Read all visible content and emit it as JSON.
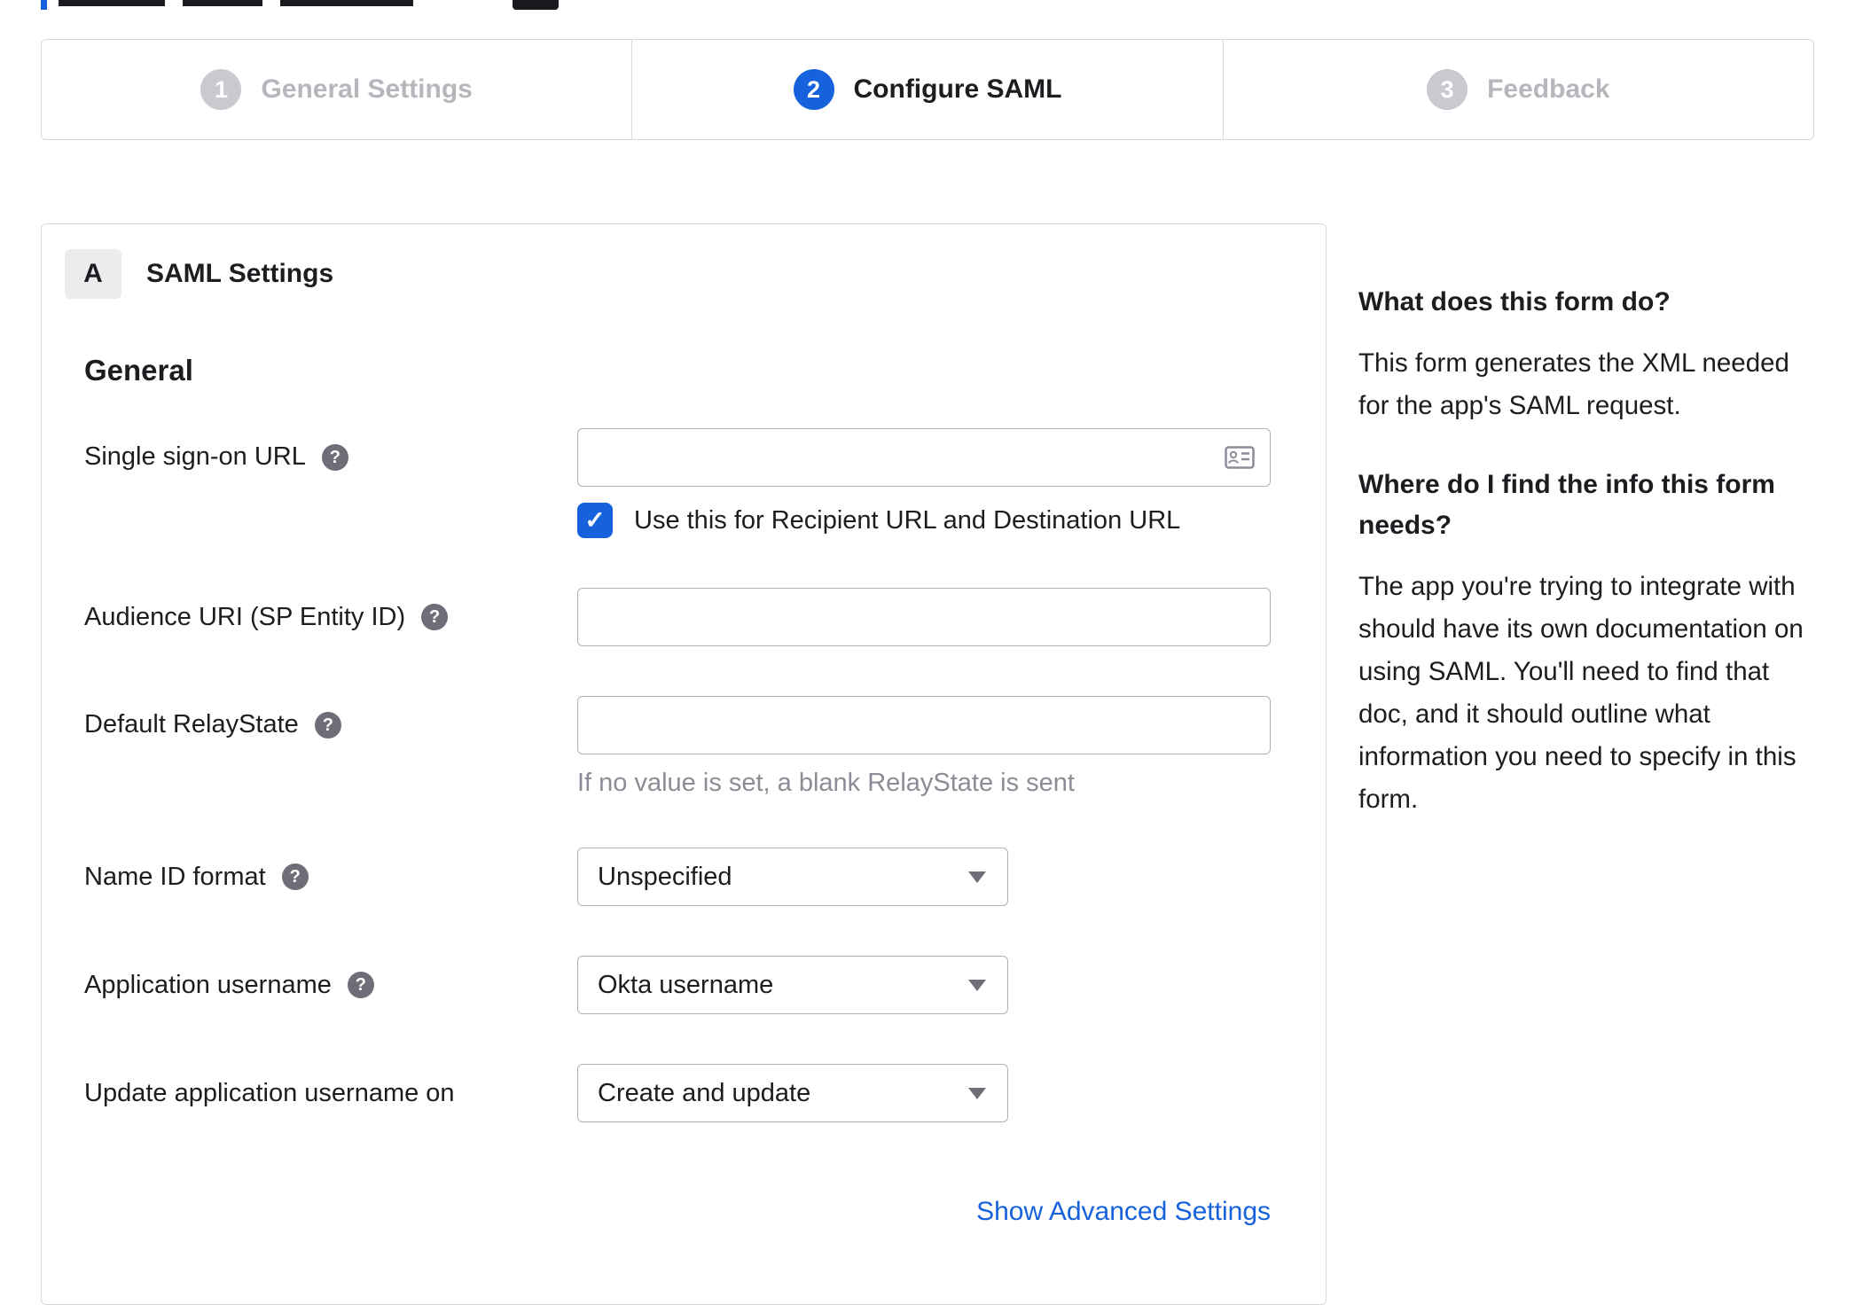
{
  "icons": {
    "help": "?",
    "check": "✓"
  },
  "stepper": {
    "steps": [
      {
        "number": "1",
        "label": "General Settings",
        "state": "inactive"
      },
      {
        "number": "2",
        "label": "Configure SAML",
        "state": "active"
      },
      {
        "number": "3",
        "label": "Feedback",
        "state": "inactive"
      }
    ]
  },
  "panel": {
    "section_badge": "A",
    "section_title": "SAML Settings",
    "group_title": "General",
    "fields": {
      "sso_url": {
        "label": "Single sign-on URL",
        "value": ""
      },
      "sso_checkbox": {
        "label": "Use this for Recipient URL and Destination URL",
        "checked": true
      },
      "audience_uri": {
        "label": "Audience URI (SP Entity ID)",
        "value": ""
      },
      "relay_state": {
        "label": "Default RelayState",
        "value": "",
        "hint": "If no value is set, a blank RelayState is sent"
      },
      "name_id_format": {
        "label": "Name ID format",
        "value": "Unspecified"
      },
      "app_username": {
        "label": "Application username",
        "value": "Okta username"
      },
      "update_app_username": {
        "label": "Update application username on",
        "value": "Create and update"
      }
    },
    "advanced_link": "Show Advanced Settings"
  },
  "sidebar": {
    "q1": "What does this form do?",
    "a1": "This form generates the XML needed for the app's SAML request.",
    "q2": "Where do I find the info this form needs?",
    "a2": "The app you're trying to integrate with should have its own documentation on using SAML. You'll need to find that doc, and it should outline what information you need to specify in this form."
  }
}
